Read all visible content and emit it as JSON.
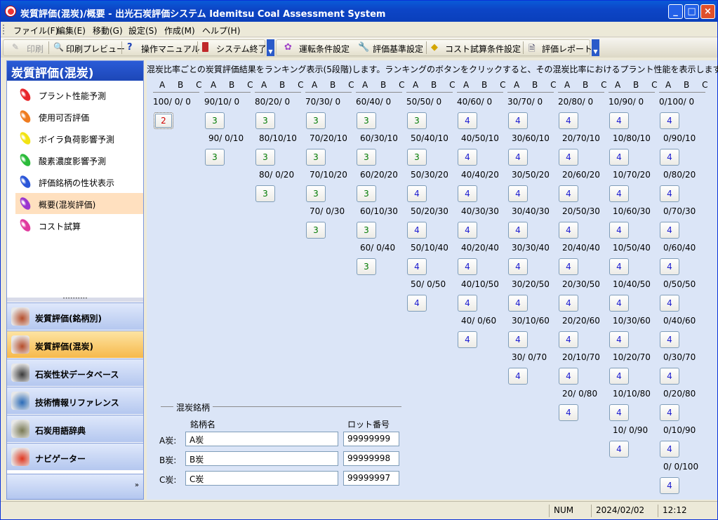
{
  "window": {
    "title": "炭質評価(混炭)/概要 - 出光石炭評価システム Idemitsu Coal Assessment System",
    "controls": {
      "minimize": "_",
      "maximize": "□",
      "close": "×"
    }
  },
  "menu": [
    "ファイル(F)",
    "編集(E)",
    "移動(G)",
    "設定(S)",
    "作成(M)",
    "ヘルプ(H)"
  ],
  "toolbar": {
    "group1": [
      "印刷",
      "印刷プレビュー",
      "操作マニュアル",
      "システム終了"
    ],
    "group2": [
      "運転条件設定",
      "評価基準設定",
      "コスト試算条件設定",
      "評価レポート"
    ]
  },
  "nav": {
    "header": "炭質評価(混炭)",
    "items": [
      "プラント性能予測",
      "使用可否評価",
      "ボイラ負荷影響予測",
      "酸素濃度影響予測",
      "評価銘柄の性状表示",
      "概要(混炭評価)",
      "コスト試算"
    ],
    "item_colors": [
      "#e8262a",
      "#ef7c1f",
      "#f2e312",
      "#2bbb3a",
      "#2a56d8",
      "#9a36cf",
      "#e03a9e"
    ],
    "selected_index": 5,
    "categories": [
      "炭質評価(銘柄別)",
      "炭質評価(混炭)",
      "石炭性状データベース",
      "技術情報リファレンス",
      "石炭用語辞典",
      "ナビゲーター"
    ],
    "category_selected_index": 1,
    "more_glyph": "»",
    "splitter_glyph": "••••••••••"
  },
  "main": {
    "description": "混炭比率ごとの炭質評価結果をランキング表示(5段階)します。ランキングのボタンをクリックすると、その混炭比率におけるプラント性能を表示します。",
    "column_header": "A B C",
    "columns": [
      {
        "entries": [
          {
            "ratio": "100/ 0/ 0",
            "rank": "2"
          }
        ]
      },
      {
        "entries": [
          {
            "ratio": "90/10/ 0",
            "rank": "3"
          },
          {
            "ratio": "90/ 0/10",
            "rank": "3"
          }
        ]
      },
      {
        "entries": [
          {
            "ratio": "80/20/ 0",
            "rank": "3"
          },
          {
            "ratio": "80/10/10",
            "rank": "3"
          },
          {
            "ratio": "80/ 0/20",
            "rank": "3"
          }
        ]
      },
      {
        "entries": [
          {
            "ratio": "70/30/ 0",
            "rank": "3"
          },
          {
            "ratio": "70/20/10",
            "rank": "3"
          },
          {
            "ratio": "70/10/20",
            "rank": "3"
          },
          {
            "ratio": "70/ 0/30",
            "rank": "3"
          }
        ]
      },
      {
        "entries": [
          {
            "ratio": "60/40/ 0",
            "rank": "3"
          },
          {
            "ratio": "60/30/10",
            "rank": "3"
          },
          {
            "ratio": "60/20/20",
            "rank": "3"
          },
          {
            "ratio": "60/10/30",
            "rank": "3"
          },
          {
            "ratio": "60/ 0/40",
            "rank": "3"
          }
        ]
      },
      {
        "entries": [
          {
            "ratio": "50/50/ 0",
            "rank": "3"
          },
          {
            "ratio": "50/40/10",
            "rank": "3"
          },
          {
            "ratio": "50/30/20",
            "rank": "4"
          },
          {
            "ratio": "50/20/30",
            "rank": "4"
          },
          {
            "ratio": "50/10/40",
            "rank": "4"
          },
          {
            "ratio": "50/ 0/50",
            "rank": "4"
          }
        ]
      },
      {
        "entries": [
          {
            "ratio": "40/60/ 0",
            "rank": "4"
          },
          {
            "ratio": "40/50/10",
            "rank": "4"
          },
          {
            "ratio": "40/40/20",
            "rank": "4"
          },
          {
            "ratio": "40/30/30",
            "rank": "4"
          },
          {
            "ratio": "40/20/40",
            "rank": "4"
          },
          {
            "ratio": "40/10/50",
            "rank": "4"
          },
          {
            "ratio": "40/ 0/60",
            "rank": "4"
          }
        ]
      },
      {
        "entries": [
          {
            "ratio": "30/70/ 0",
            "rank": "4"
          },
          {
            "ratio": "30/60/10",
            "rank": "4"
          },
          {
            "ratio": "30/50/20",
            "rank": "4"
          },
          {
            "ratio": "30/40/30",
            "rank": "4"
          },
          {
            "ratio": "30/30/40",
            "rank": "4"
          },
          {
            "ratio": "30/20/50",
            "rank": "4"
          },
          {
            "ratio": "30/10/60",
            "rank": "4"
          },
          {
            "ratio": "30/ 0/70",
            "rank": "4"
          }
        ]
      },
      {
        "entries": [
          {
            "ratio": "20/80/ 0",
            "rank": "4"
          },
          {
            "ratio": "20/70/10",
            "rank": "4"
          },
          {
            "ratio": "20/60/20",
            "rank": "4"
          },
          {
            "ratio": "20/50/30",
            "rank": "4"
          },
          {
            "ratio": "20/40/40",
            "rank": "4"
          },
          {
            "ratio": "20/30/50",
            "rank": "4"
          },
          {
            "ratio": "20/20/60",
            "rank": "4"
          },
          {
            "ratio": "20/10/70",
            "rank": "4"
          },
          {
            "ratio": "20/ 0/80",
            "rank": "4"
          }
        ]
      },
      {
        "entries": [
          {
            "ratio": "10/90/ 0",
            "rank": "4"
          },
          {
            "ratio": "10/80/10",
            "rank": "4"
          },
          {
            "ratio": "10/70/20",
            "rank": "4"
          },
          {
            "ratio": "10/60/30",
            "rank": "4"
          },
          {
            "ratio": "10/50/40",
            "rank": "4"
          },
          {
            "ratio": "10/40/50",
            "rank": "4"
          },
          {
            "ratio": "10/30/60",
            "rank": "4"
          },
          {
            "ratio": "10/20/70",
            "rank": "4"
          },
          {
            "ratio": "10/10/80",
            "rank": "4"
          },
          {
            "ratio": "10/ 0/90",
            "rank": "4"
          }
        ]
      },
      {
        "entries": [
          {
            "ratio": "0/100/ 0",
            "rank": "4"
          },
          {
            "ratio": "0/90/10",
            "rank": "4"
          },
          {
            "ratio": "0/80/20",
            "rank": "4"
          },
          {
            "ratio": "0/70/30",
            "rank": "4"
          },
          {
            "ratio": "0/60/40",
            "rank": "4"
          },
          {
            "ratio": "0/50/50",
            "rank": "4"
          },
          {
            "ratio": "0/40/60",
            "rank": "4"
          },
          {
            "ratio": "0/30/70",
            "rank": "4"
          },
          {
            "ratio": "0/20/80",
            "rank": "4"
          },
          {
            "ratio": "0/10/90",
            "rank": "4"
          },
          {
            "ratio": "0/ 0/100",
            "rank": "4"
          }
        ]
      }
    ],
    "blend": {
      "group_title": "混炭銘柄",
      "col_brand": "銘柄名",
      "col_lot": "ロット番号",
      "rows": [
        {
          "label": "A炭:",
          "brand": "A炭",
          "lot": "99999999"
        },
        {
          "label": "B炭:",
          "brand": "B炭",
          "lot": "99999998"
        },
        {
          "label": "C炭:",
          "brand": "C炭",
          "lot": "99999997"
        }
      ]
    }
  },
  "status": {
    "num": "NUM",
    "date": "2024/02/02",
    "time": "12:12"
  }
}
